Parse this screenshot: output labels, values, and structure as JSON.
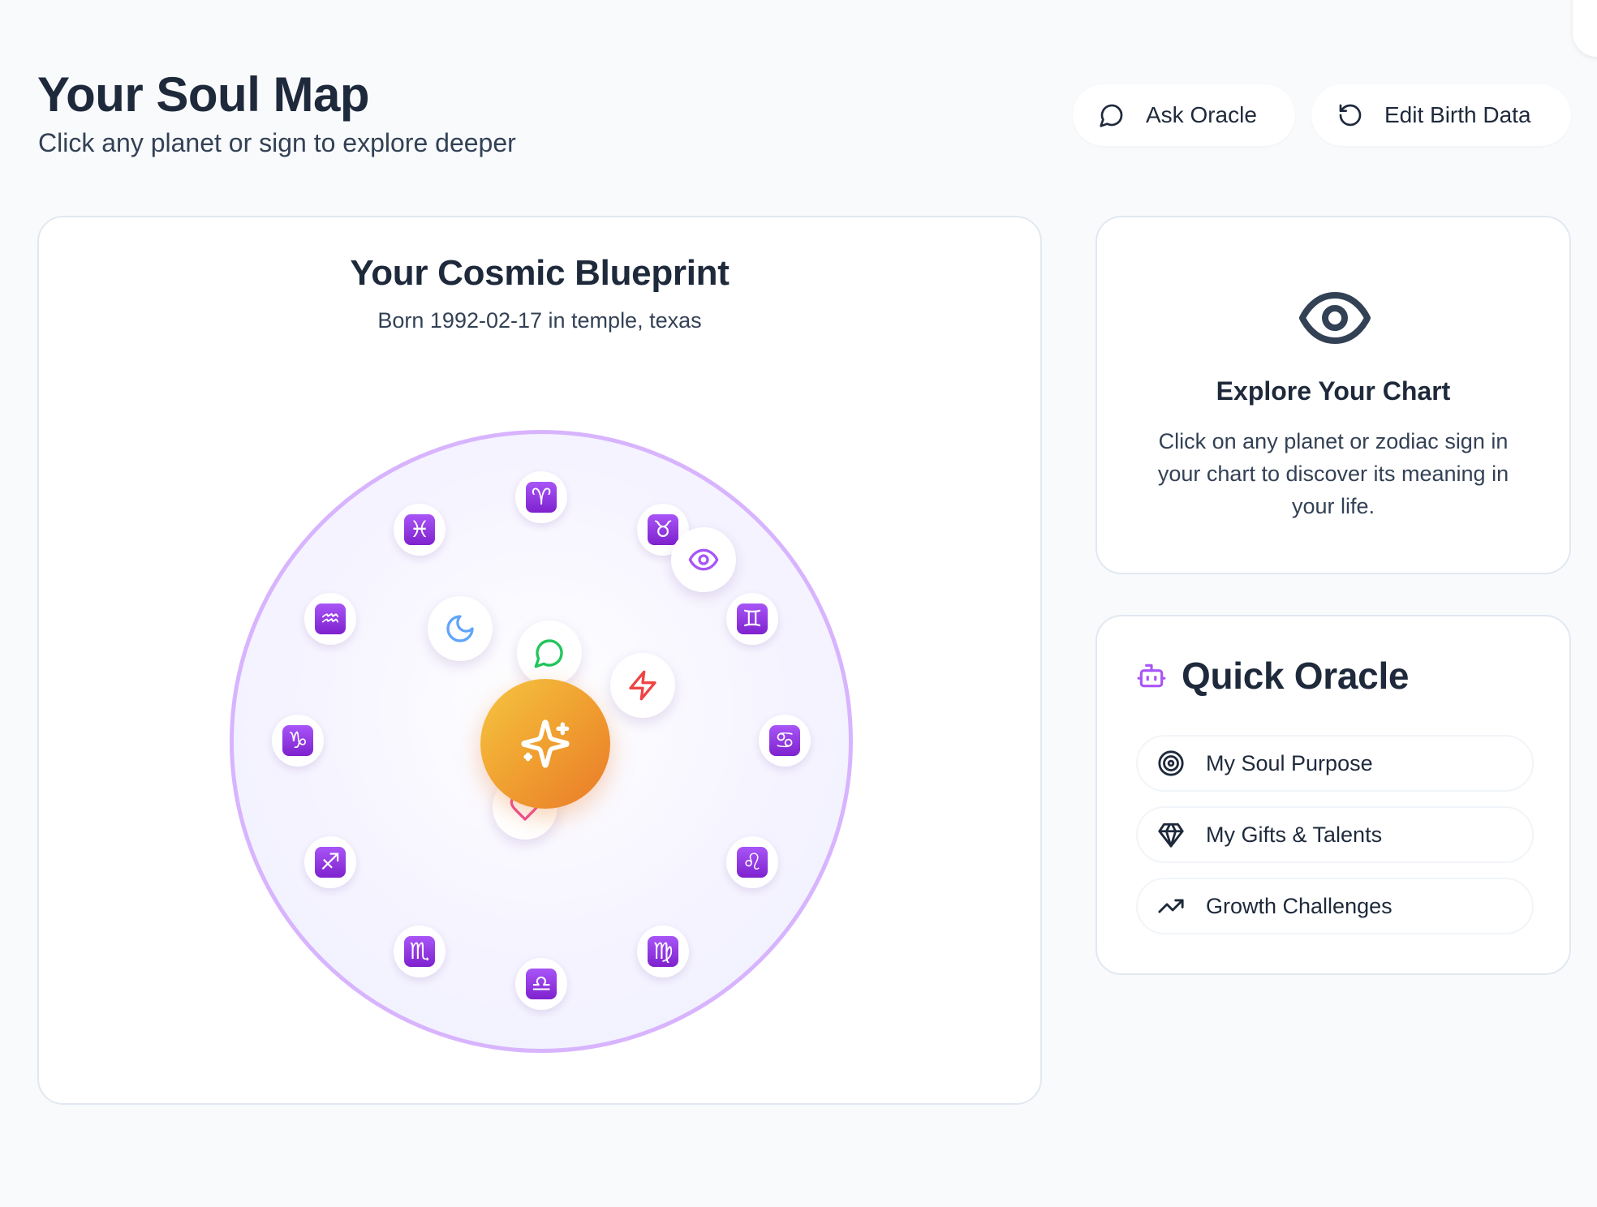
{
  "header": {
    "title": "Your Soul Map",
    "subtitle": "Click any planet or sign to explore deeper",
    "ask_oracle_label": "Ask Oracle",
    "edit_birth_label": "Edit Birth Data"
  },
  "chart": {
    "title": "Your Cosmic Blueprint",
    "birth_info": "Born 1992-02-17 in temple, texas",
    "signs": [
      {
        "name": "aries",
        "glyph": "♈"
      },
      {
        "name": "taurus",
        "glyph": "♉"
      },
      {
        "name": "gemini",
        "glyph": "♊"
      },
      {
        "name": "cancer",
        "glyph": "♋"
      },
      {
        "name": "leo",
        "glyph": "♌"
      },
      {
        "name": "virgo",
        "glyph": "♍"
      },
      {
        "name": "libra",
        "glyph": "♎"
      },
      {
        "name": "scorpio",
        "glyph": "♏"
      },
      {
        "name": "sagittarius",
        "glyph": "♐"
      },
      {
        "name": "capricorn",
        "glyph": "♑"
      },
      {
        "name": "aquarius",
        "glyph": "♒"
      },
      {
        "name": "pisces",
        "glyph": "♓"
      }
    ],
    "planet_icons": [
      "moon-icon",
      "eye-icon",
      "message-circle-icon",
      "lightning-icon",
      "heart-icon",
      "sparkles-icon"
    ],
    "colors": {
      "ring": "#d8b4fe",
      "sign_badge": "#9333ea",
      "sun_gradient_start": "#f5c542",
      "sun_gradient_end": "#ea7a2a",
      "moon": "#60a5fa",
      "eye": "#a855f7",
      "message": "#22c55e",
      "lightning": "#ef4444",
      "heart": "#ec4899"
    }
  },
  "explore": {
    "icon": "eye-icon",
    "title": "Explore Your Chart",
    "text": "Click on any planet or zodiac sign in your chart to discover its meaning in your life."
  },
  "quick_oracle": {
    "icon": "bot-icon",
    "title": "Quick Oracle",
    "items": [
      {
        "label": "My Soul Purpose",
        "icon": "target-icon"
      },
      {
        "label": "My Gifts & Talents",
        "icon": "gem-icon"
      },
      {
        "label": "Growth Challenges",
        "icon": "trending-up-icon"
      }
    ]
  }
}
